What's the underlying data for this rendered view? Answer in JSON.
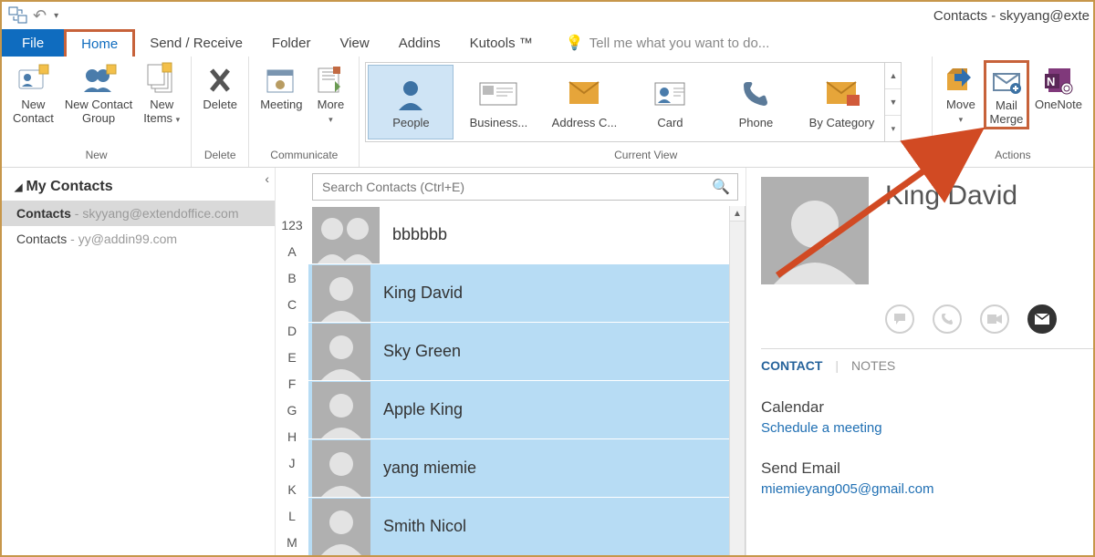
{
  "window": {
    "title": "Contacts - skyyang@exte"
  },
  "tabs": {
    "file": "File",
    "home": "Home",
    "sendreceive": "Send / Receive",
    "folder": "Folder",
    "view": "View",
    "addins": "Addins",
    "kutools": "Kutools ™",
    "tellme": "Tell me what you want to do..."
  },
  "ribbon": {
    "new": {
      "label": "New",
      "new_contact": "New\nContact",
      "new_group": "New Contact\nGroup",
      "new_items": "New\nItems"
    },
    "delete": {
      "label": "Delete",
      "btn": "Delete"
    },
    "communicate": {
      "label": "Communicate",
      "meeting": "Meeting",
      "more": "More"
    },
    "currentview": {
      "label": "Current View",
      "items": [
        "People",
        "Business...",
        "Address C...",
        "Card",
        "Phone",
        "By Category"
      ]
    },
    "actions": {
      "label": "Actions",
      "move": "Move",
      "mailmerge": "Mail\nMerge",
      "onenote": "OneNote"
    }
  },
  "nav": {
    "header": "My Contacts",
    "items": [
      {
        "prefix": "Contacts",
        "account": " - skyyang@extendoffice.com",
        "selected": true
      },
      {
        "prefix": "Contacts",
        "account": " - yy@addin99.com",
        "selected": false
      }
    ]
  },
  "search": {
    "placeholder": "Search Contacts (Ctrl+E)"
  },
  "alpha": [
    "123",
    "A",
    "B",
    "C",
    "D",
    "E",
    "F",
    "G",
    "H",
    "J",
    "K",
    "L",
    "M"
  ],
  "contacts": [
    {
      "name": "bbbbbb",
      "selected": false,
      "double": true
    },
    {
      "name": "King David",
      "selected": true
    },
    {
      "name": "Sky Green",
      "selected": true
    },
    {
      "name": "Apple King",
      "selected": true
    },
    {
      "name": "yang miemie",
      "selected": true
    },
    {
      "name": "Smith Nicol",
      "selected": true
    }
  ],
  "reading": {
    "name": "King David",
    "tabs": {
      "contact": "CONTACT",
      "notes": "NOTES"
    },
    "calendar_label": "Calendar",
    "schedule_link": "Schedule a meeting",
    "sendemail_label": "Send Email",
    "email": "miemieyang005@gmail.com"
  }
}
